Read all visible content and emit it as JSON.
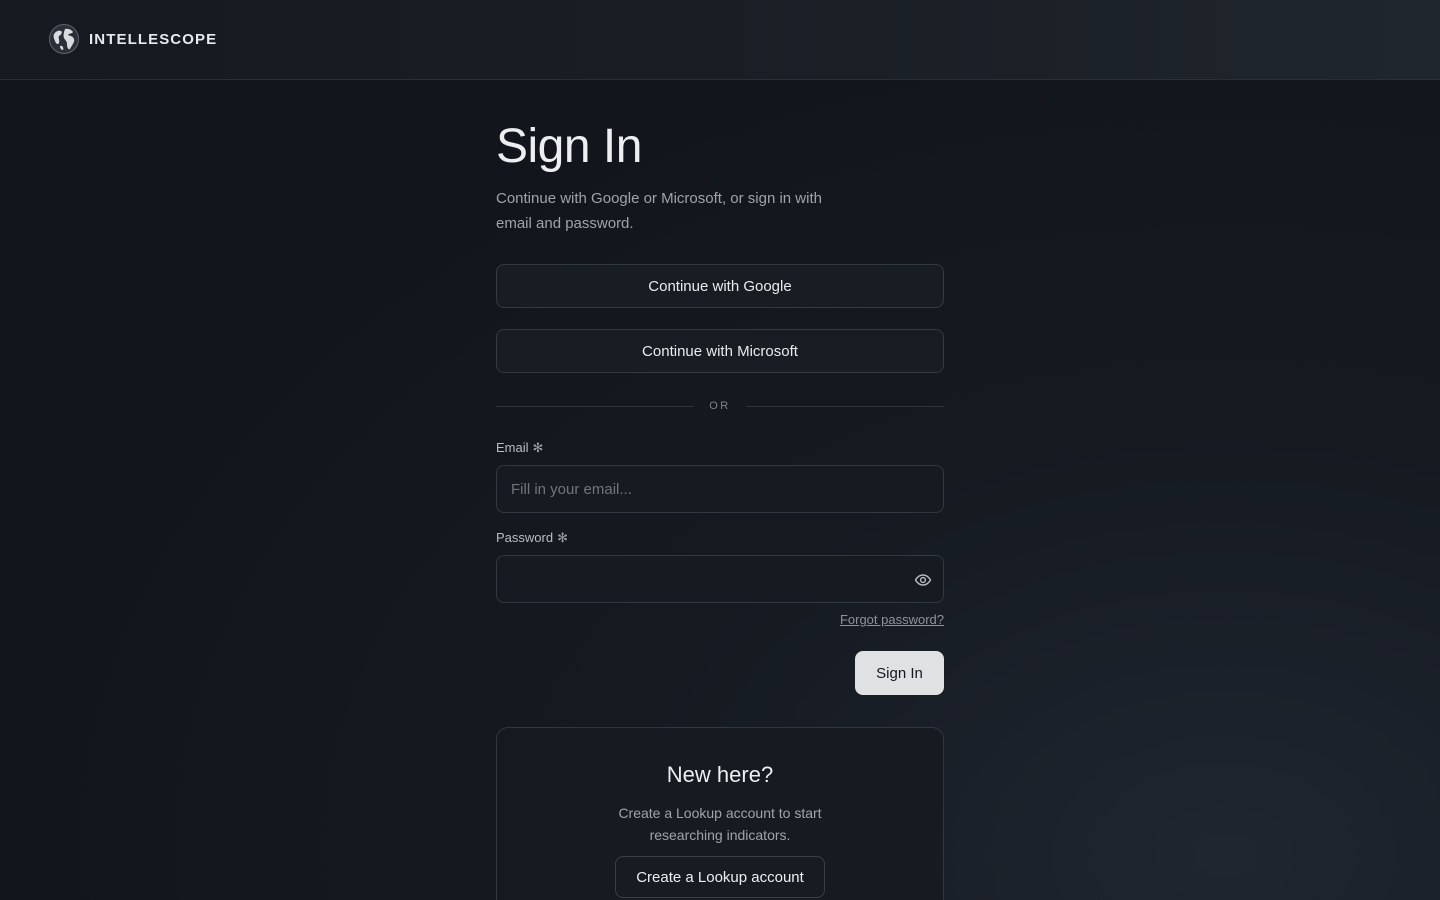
{
  "header": {
    "brand_name": "INTELLESCOPE",
    "logo_icon": "globe-icon"
  },
  "signin": {
    "title": "Sign In",
    "subtitle": "Continue with Google or Microsoft, or sign in with email and password.",
    "google_button": "Continue with Google",
    "microsoft_button": "Continue with Microsoft",
    "divider_text": "OR",
    "email": {
      "label": "Email",
      "required_mark": "✻",
      "value": "",
      "placeholder": "Fill in your email..."
    },
    "password": {
      "label": "Password",
      "required_mark": "✻",
      "value": "",
      "toggle_icon": "eye-icon"
    },
    "forgot_link": "Forgot password?",
    "submit_button": "Sign In"
  },
  "register": {
    "title": "New here?",
    "description": "Create a Lookup account to start researching indicators.",
    "button": "Create a Lookup account"
  },
  "colors": {
    "background": "#13171d",
    "primary_button": "#dfe1e3",
    "border": "#343a42"
  }
}
